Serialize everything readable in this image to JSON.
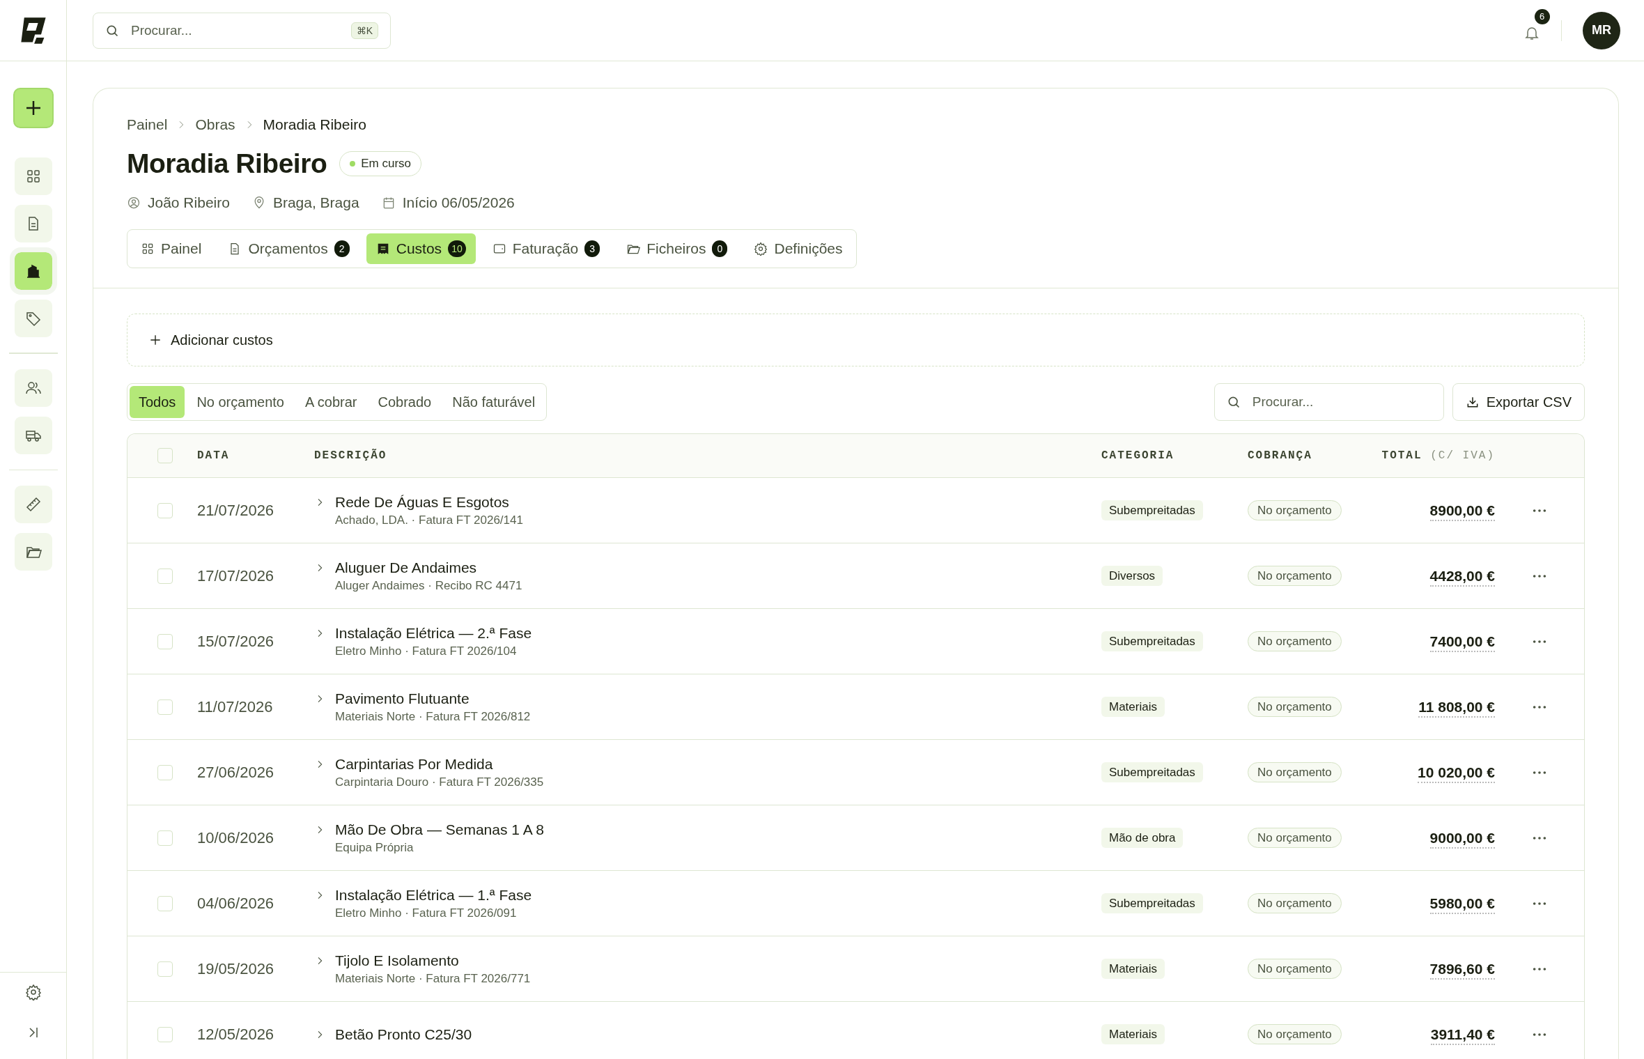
{
  "topbar": {
    "search": {
      "placeholder": "Procurar...",
      "shortcut": "⌘K"
    },
    "notifications": "6",
    "avatar": "MR"
  },
  "sidebar": {
    "items": [
      {
        "selected": false
      },
      {
        "selected": false
      },
      {
        "selected": true
      },
      {
        "selected": false
      },
      {
        "selected": false
      },
      {
        "selected": false
      },
      {
        "selected": false
      },
      {
        "selected": false
      }
    ]
  },
  "breadcrumb": [
    "Painel",
    "Obras",
    "Moradia Ribeiro"
  ],
  "title": "Moradia Ribeiro",
  "status": "Em curso",
  "meta": [
    {
      "text": "João Ribeiro"
    },
    {
      "text": "Braga, Braga"
    },
    {
      "text": "Início 06/05/2026"
    }
  ],
  "tabs": [
    {
      "label": "Painel",
      "selected": false
    },
    {
      "label": "Orçamentos",
      "count": "2",
      "selected": false
    },
    {
      "label": "Custos",
      "count": "10",
      "selected": true
    },
    {
      "label": "Faturação",
      "count": "3",
      "selected": false
    },
    {
      "label": "Ficheiros",
      "count": "0",
      "selected": false
    },
    {
      "label": "Definições",
      "selected": false
    }
  ],
  "add_button": "Adicionar custos",
  "filters": [
    {
      "label": "Todos",
      "selected": true
    },
    {
      "label": "No orçamento",
      "selected": false
    },
    {
      "label": "A cobrar",
      "selected": false
    },
    {
      "label": "Cobrado",
      "selected": false
    },
    {
      "label": "Não faturável",
      "selected": false
    }
  ],
  "table_search": {
    "placeholder": "Procurar..."
  },
  "export_button": "Exportar CSV",
  "table": {
    "select_all": {
      "checked": false
    },
    "columns": [
      {
        "label": "DATA"
      },
      {
        "label": "DESCRIÇÃO"
      },
      {
        "label": "CATEGORIA"
      },
      {
        "label": "COBRANÇA"
      },
      {
        "label": "TOTAL",
        "note": "(C/ IVA)"
      }
    ],
    "rows": [
      {
        "checked": false,
        "date": "21/07/2026",
        "title": "Rede De Águas E Esgotos",
        "subtitle": "Achado, LDA. · Fatura FT 2026/141",
        "category": "Subempreitadas",
        "billing": "No orçamento",
        "total": "8900,00 €"
      },
      {
        "checked": false,
        "date": "17/07/2026",
        "title": "Aluguer De Andaimes",
        "subtitle": "Aluger Andaimes · Recibo RC 4471",
        "category": "Diversos",
        "billing": "No orçamento",
        "total": "4428,00 €"
      },
      {
        "checked": false,
        "date": "15/07/2026",
        "title": "Instalação Elétrica — 2.ª Fase",
        "subtitle": "Eletro Minho · Fatura FT 2026/104",
        "category": "Subempreitadas",
        "billing": "No orçamento",
        "total": "7400,00 €"
      },
      {
        "checked": false,
        "date": "11/07/2026",
        "title": "Pavimento Flutuante",
        "subtitle": "Materiais Norte · Fatura FT 2026/812",
        "category": "Materiais",
        "billing": "No orçamento",
        "total": "11 808,00 €"
      },
      {
        "checked": false,
        "date": "27/06/2026",
        "title": "Carpintarias Por Medida",
        "subtitle": "Carpintaria Douro · Fatura FT 2026/335",
        "category": "Subempreitadas",
        "billing": "No orçamento",
        "total": "10 020,00 €"
      },
      {
        "checked": false,
        "date": "10/06/2026",
        "title": "Mão De Obra — Semanas 1 A 8",
        "subtitle": "Equipa Própria",
        "category": "Mão de obra",
        "billing": "No orçamento",
        "total": "9000,00 €"
      },
      {
        "checked": false,
        "date": "04/06/2026",
        "title": "Instalação Elétrica — 1.ª Fase",
        "subtitle": "Eletro Minho · Fatura FT 2026/091",
        "category": "Subempreitadas",
        "billing": "No orçamento",
        "total": "5980,00 €"
      },
      {
        "checked": false,
        "date": "19/05/2026",
        "title": "Tijolo E Isolamento",
        "subtitle": "Materiais Norte · Fatura FT 2026/771",
        "category": "Materiais",
        "billing": "No orçamento",
        "total": "7896,60 €"
      },
      {
        "checked": false,
        "date": "12/05/2026",
        "title": "Betão Pronto C25/30",
        "category": "Materiais",
        "billing": "No orçamento",
        "total": "3911,40 €"
      }
    ]
  }
}
